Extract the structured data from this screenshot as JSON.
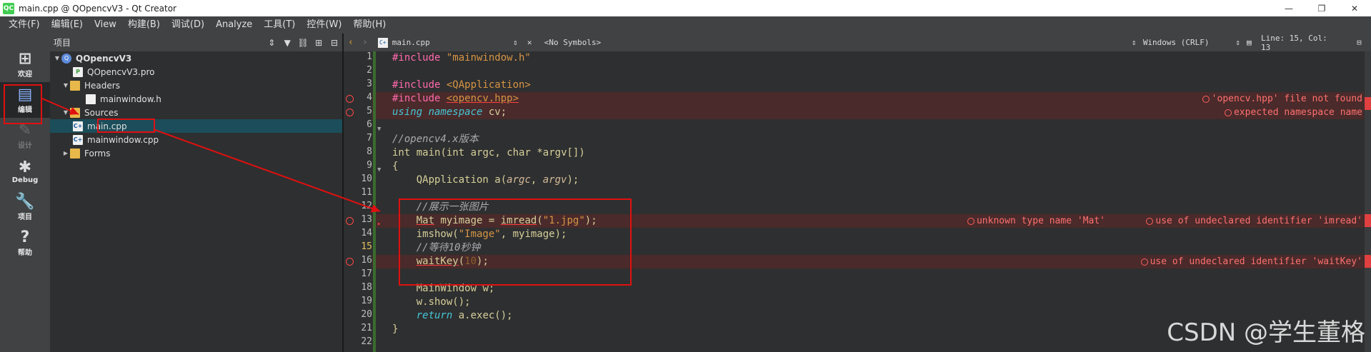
{
  "window": {
    "title": "main.cpp @ QOpencvV3 - Qt Creator",
    "icon_label": "QC",
    "minimize": "—",
    "maximize": "❐",
    "close": "✕"
  },
  "menu": [
    "文件(F)",
    "编辑(E)",
    "View",
    "构建(B)",
    "调试(D)",
    "Analyze",
    "工具(T)",
    "控件(W)",
    "帮助(H)"
  ],
  "modes": [
    {
      "label": "欢迎",
      "icon": "grid-icon"
    },
    {
      "label": "编辑",
      "icon": "edit-doc-icon"
    },
    {
      "label": "设计",
      "icon": "pen-icon"
    },
    {
      "label": "Debug",
      "icon": "bug-icon"
    },
    {
      "label": "项目",
      "icon": "wrench-icon"
    },
    {
      "label": "帮助",
      "icon": "help-icon"
    }
  ],
  "project_pane": {
    "title": "项目",
    "tree": [
      {
        "label": "QOpencvV3",
        "kind": "project",
        "bold": true
      },
      {
        "label": "QOpencvV3.pro",
        "kind": "pro"
      },
      {
        "label": "Headers",
        "kind": "folder"
      },
      {
        "label": "mainwindow.h",
        "kind": "header"
      },
      {
        "label": "Sources",
        "kind": "folder"
      },
      {
        "label": "main.cpp",
        "kind": "cpp",
        "selected": true
      },
      {
        "label": "mainwindow.cpp",
        "kind": "cpp"
      },
      {
        "label": "Forms",
        "kind": "folder"
      }
    ]
  },
  "editor_toolbar": {
    "file": "main.cpp",
    "symbols": "<No Symbols>",
    "line_ending": "Windows (CRLF)",
    "position": "Line: 15, Col: 13"
  },
  "editor": {
    "current_line": 15,
    "error_lines": [
      4,
      5,
      13,
      16
    ],
    "lines": [
      "#include \"mainwindow.h\"",
      "",
      "#include <QApplication>",
      "#include <opencv.hpp>",
      "using namespace cv;",
      "",
      "//opencv4.x版本",
      "int main(int argc, char *argv[])",
      "{",
      "    QApplication a(argc, argv);",
      "",
      "    //展示一张图片",
      "    Mat myimage = imread(\"1.jpg\");",
      "    imshow(\"Image\", myimage);",
      "    //等待10秒钟",
      "    waitKey(10);",
      "",
      "    MainWindow w;",
      "    w.show();",
      "    return a.exec();",
      "}",
      ""
    ],
    "diagnostics": [
      {
        "line": 4,
        "text": "'opencv.hpp' file not found"
      },
      {
        "line": 5,
        "text": "expected namespace name"
      },
      {
        "line": 13,
        "text": "unknown type name 'Mat'"
      },
      {
        "line": 13,
        "text": "use of undeclared identifier 'imread'"
      },
      {
        "line": 16,
        "text": "use of undeclared identifier 'waitKey'"
      }
    ]
  },
  "watermark": "CSDN @学生董格"
}
